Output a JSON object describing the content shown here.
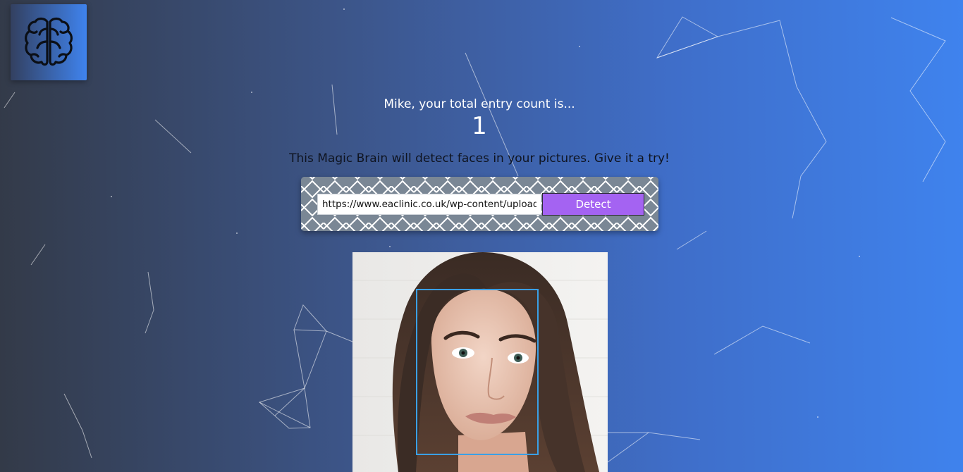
{
  "app": {
    "logo_icon": "brain-icon"
  },
  "rank": {
    "greeting": "Mike, your total entry count is...",
    "count": "1"
  },
  "intro": {
    "text": "This Magic Brain will detect faces in your pictures. Give it a try!"
  },
  "image_form": {
    "url_value": "https://www.eaclinic.co.uk/wp-content/uploads/",
    "detect_label": "Detect"
  },
  "face_detection": {
    "box_color": "#3aa0e6"
  },
  "colors": {
    "background_start": "#333a48",
    "background_end": "#3f83ee",
    "detect_button": "#a463f2",
    "form_background": "#7a8795"
  }
}
